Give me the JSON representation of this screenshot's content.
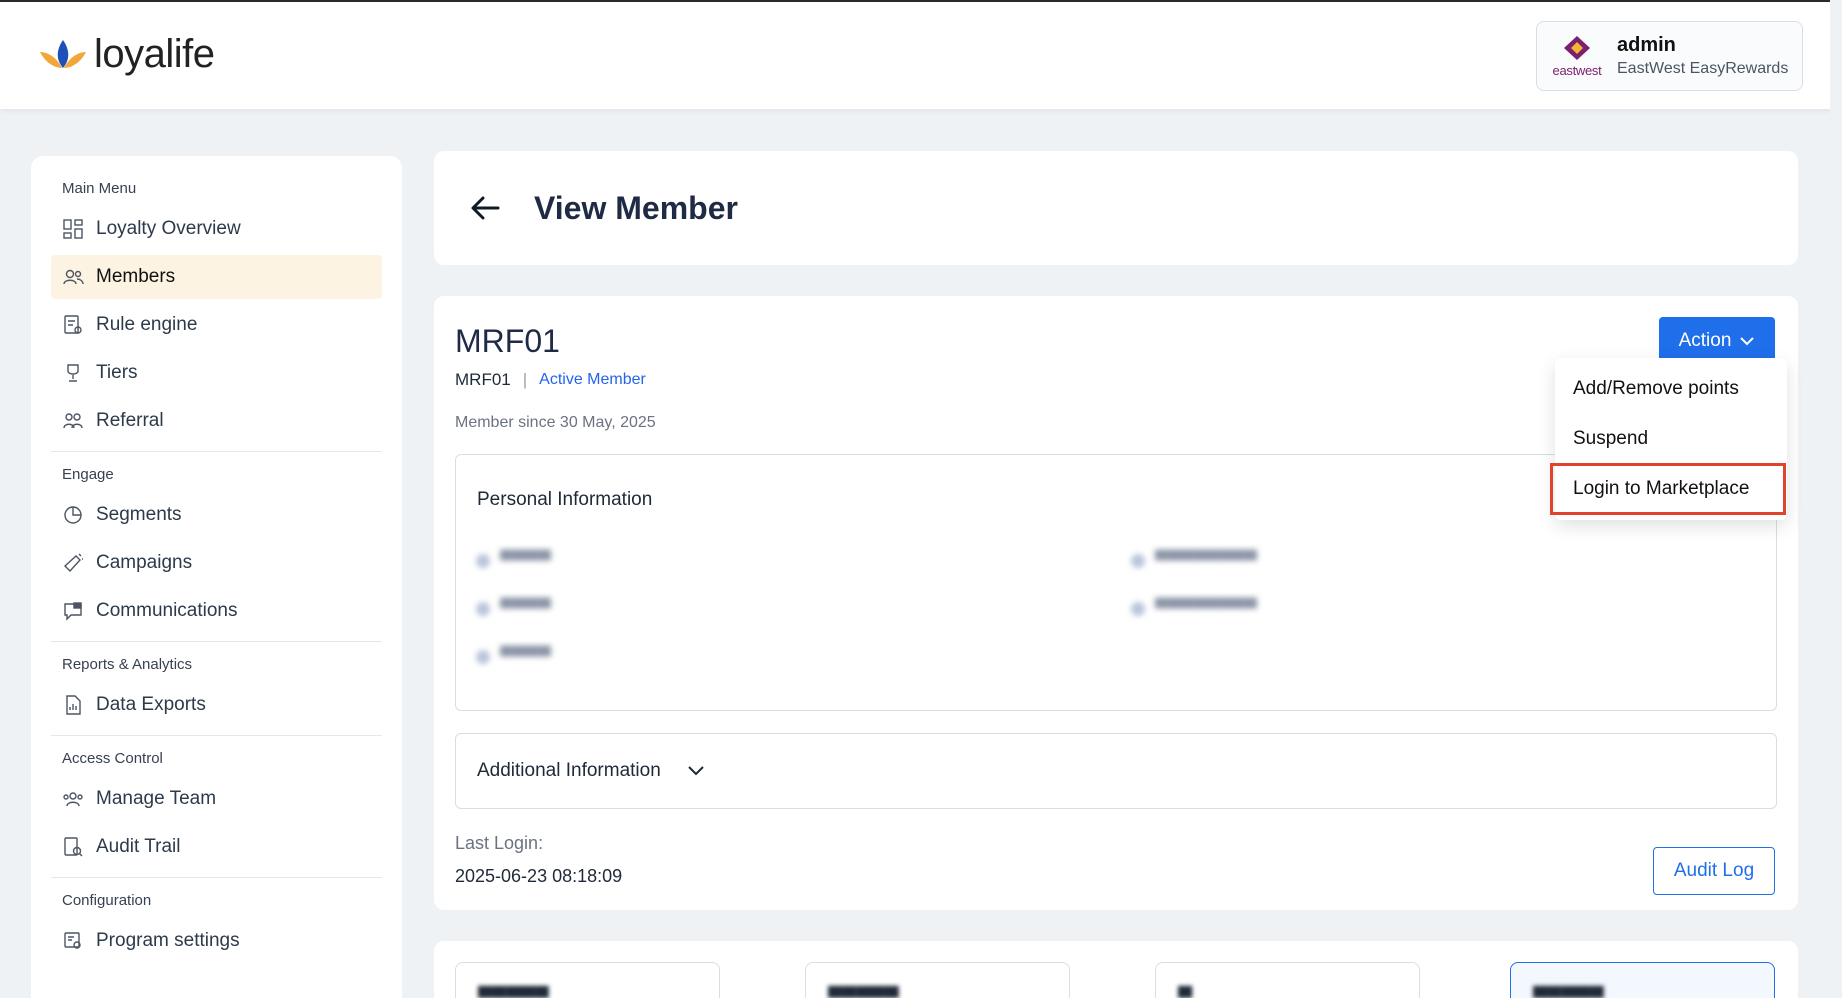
{
  "brand": {
    "logo_text": "loyalife"
  },
  "account": {
    "name": "admin",
    "org": "EastWest EasyRewards",
    "logo_text": "eastwest"
  },
  "sidebar": {
    "sections": [
      {
        "title": "Main Menu",
        "items": [
          {
            "label": "Loyalty Overview",
            "icon": "dashboard-icon"
          },
          {
            "label": "Members",
            "icon": "members-icon"
          },
          {
            "label": "Rule engine",
            "icon": "rule-engine-icon"
          },
          {
            "label": "Tiers",
            "icon": "trophy-icon"
          },
          {
            "label": "Referral",
            "icon": "referral-icon"
          }
        ]
      },
      {
        "title": "Engage",
        "items": [
          {
            "label": "Segments",
            "icon": "pie-chart-icon"
          },
          {
            "label": "Campaigns",
            "icon": "megaphone-icon"
          },
          {
            "label": "Communications",
            "icon": "chat-icon"
          }
        ]
      },
      {
        "title": "Reports & Analytics",
        "items": [
          {
            "label": "Data Exports",
            "icon": "file-chart-icon"
          }
        ]
      },
      {
        "title": "Access Control",
        "items": [
          {
            "label": "Manage Team",
            "icon": "team-icon"
          },
          {
            "label": "Audit Trail",
            "icon": "audit-trail-icon"
          }
        ]
      },
      {
        "title": "Configuration",
        "items": [
          {
            "label": "Program settings",
            "icon": "settings-icon"
          }
        ]
      }
    ],
    "active": "Members"
  },
  "header": {
    "title": "View Member"
  },
  "member": {
    "id_heading": "MRF01",
    "id": "MRF01",
    "status": "Active Member",
    "member_since": "Member since 30 May, 2025",
    "personal_info_title": "Personal Information",
    "additional_info_title": "Additional Information",
    "last_login_label": "Last Login:",
    "last_login_value": "2025-06-23 08:18:09"
  },
  "actions": {
    "button_label": "Action",
    "menu": [
      "Add/Remove points",
      "Suspend",
      "Login to Marketplace"
    ],
    "highlighted": "Login to Marketplace"
  },
  "audit_button_label": "Audit Log",
  "colors": {
    "primary": "#1f6feb",
    "active_nav_bg": "#fdf3e3",
    "highlight_outline": "#e0432b"
  }
}
